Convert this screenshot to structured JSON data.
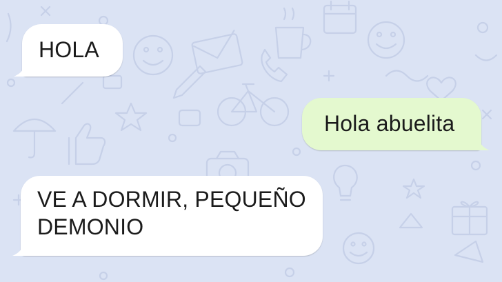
{
  "chat": {
    "background_color": "#dbe3f4",
    "incoming_bubble_color": "#ffffff",
    "outgoing_bubble_color": "#e4f9cf",
    "messages": [
      {
        "direction": "incoming",
        "text": "HOLA"
      },
      {
        "direction": "outgoing",
        "text": "Hola abuelita"
      },
      {
        "direction": "incoming",
        "lines": [
          "VE A DORMIR, PEQUEÑO",
          "DEMONIO"
        ]
      }
    ]
  }
}
